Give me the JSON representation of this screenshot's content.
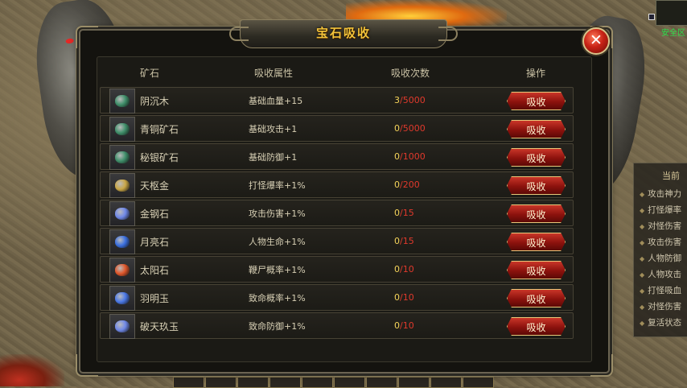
{
  "window": {
    "title": "宝石吸收",
    "close_icon": "✕"
  },
  "columns": {
    "ore": "矿石",
    "attribute": "吸收属性",
    "count": "吸收次数",
    "action": "操作"
  },
  "gems": [
    {
      "name": "阴沉木",
      "attribute": "基础血量+15",
      "current": "3",
      "max": "/5000",
      "button": "吸收",
      "icon": "green-gem-icon",
      "color": "#3f8f6a"
    },
    {
      "name": "青铜矿石",
      "attribute": "基础攻击+1",
      "current": "0",
      "max": "/5000",
      "button": "吸收",
      "icon": "green-gem-icon",
      "color": "#3f8f6a"
    },
    {
      "name": "秘银矿石",
      "attribute": "基础防御+1",
      "current": "0",
      "max": "/1000",
      "button": "吸收",
      "icon": "green-gem-icon",
      "color": "#3f8f6a"
    },
    {
      "name": "天枢金",
      "attribute": "打怪爆率+1%",
      "current": "0",
      "max": "/200",
      "button": "吸收",
      "icon": "gold-bar-icon",
      "color": "#c9a646"
    },
    {
      "name": "金钢石",
      "attribute": "攻击伤害+1%",
      "current": "0",
      "max": "/15",
      "button": "吸收",
      "icon": "blue-crystal-icon",
      "color": "#6f88e8"
    },
    {
      "name": "月亮石",
      "attribute": "人物生命+1%",
      "current": "0",
      "max": "/15",
      "button": "吸收",
      "icon": "blue-orb-icon",
      "color": "#3a6fe0"
    },
    {
      "name": "太阳石",
      "attribute": "鞭尸概率+1%",
      "current": "0",
      "max": "/10",
      "button": "吸收",
      "icon": "sun-orb-icon",
      "color": "#e0562a"
    },
    {
      "name": "羽明玉",
      "attribute": "致命概率+1%",
      "current": "0",
      "max": "/10",
      "button": "吸收",
      "icon": "blue-orb-icon",
      "color": "#4a78e8"
    },
    {
      "name": "破天玖玉",
      "attribute": "致命防御+1%",
      "current": "0",
      "max": "/10",
      "button": "吸收",
      "icon": "blue-crystal-icon",
      "color": "#6f88e8"
    }
  ],
  "side_panel": {
    "title": "当前",
    "items": [
      "攻击神力",
      "打怪爆率",
      "对怪伤害",
      "攻击伤害",
      "人物防御",
      "人物攻击",
      "打怪吸血",
      "对怪伤害",
      "复活状态"
    ]
  },
  "minimap": {
    "label": "安全区"
  },
  "colors": {
    "title": "#f3c33a",
    "count_current": "#f4d35a",
    "count_max": "#e0392c",
    "button_red": "#c93528"
  }
}
